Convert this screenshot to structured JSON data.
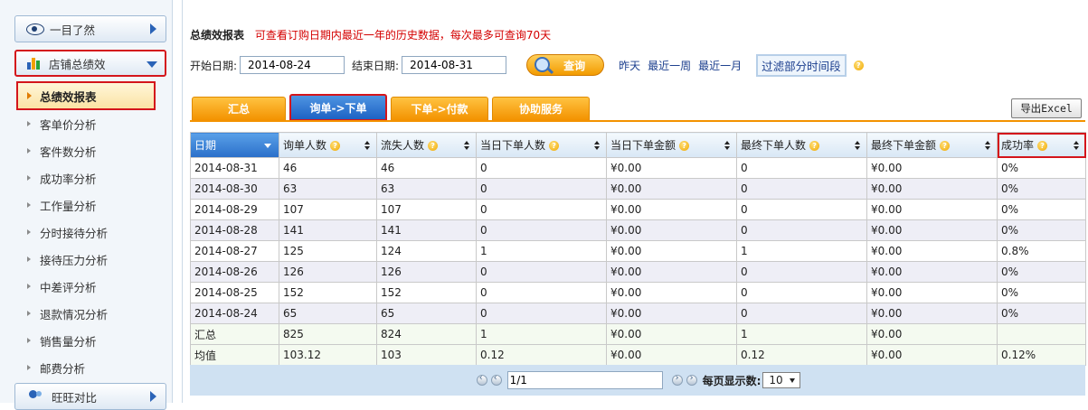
{
  "sidebar": {
    "overview_label": "一目了然",
    "store_label": "店铺总绩效",
    "active_item": "总绩效报表",
    "items": [
      "客单价分析",
      "客件数分析",
      "成功率分析",
      "工作量分析",
      "分时接待分析",
      "接待压力分析",
      "中差评分析",
      "退款情况分析",
      "销售量分析",
      "邮费分析"
    ],
    "wangwang_label": "旺旺对比"
  },
  "header": {
    "title": "总绩效报表",
    "note": "可查看订购日期内最近一年的历史数据，每次最多可查询70天"
  },
  "filter": {
    "start_label": "开始日期:",
    "start_value": "2014-08-24",
    "end_label": "结束日期:",
    "end_value": "2014-08-31",
    "query_label": "查询",
    "quick_links": [
      "昨天",
      "最近一周",
      "最近一月"
    ],
    "partial_label": "过滤部分时间段"
  },
  "tabs": [
    "汇总",
    "询单->下单",
    "下单->付款",
    "协助服务"
  ],
  "active_tab": 1,
  "export_label": "导出Excel",
  "table": {
    "columns": [
      "日期",
      "询单人数",
      "流失人数",
      "当日下单人数",
      "当日下单金额",
      "最终下单人数",
      "最终下单金额",
      "成功率"
    ],
    "rows": [
      [
        "2014-08-31",
        "46",
        "46",
        "0",
        "¥0.00",
        "0",
        "¥0.00",
        "0%"
      ],
      [
        "2014-08-30",
        "63",
        "63",
        "0",
        "¥0.00",
        "0",
        "¥0.00",
        "0%"
      ],
      [
        "2014-08-29",
        "107",
        "107",
        "0",
        "¥0.00",
        "0",
        "¥0.00",
        "0%"
      ],
      [
        "2014-08-28",
        "141",
        "141",
        "0",
        "¥0.00",
        "0",
        "¥0.00",
        "0%"
      ],
      [
        "2014-08-27",
        "125",
        "124",
        "1",
        "¥0.00",
        "1",
        "¥0.00",
        "0.8%"
      ],
      [
        "2014-08-26",
        "126",
        "126",
        "0",
        "¥0.00",
        "0",
        "¥0.00",
        "0%"
      ],
      [
        "2014-08-25",
        "152",
        "152",
        "0",
        "¥0.00",
        "0",
        "¥0.00",
        "0%"
      ],
      [
        "2014-08-24",
        "65",
        "65",
        "0",
        "¥0.00",
        "0",
        "¥0.00",
        "0%"
      ]
    ],
    "summary": [
      "汇总",
      "825",
      "824",
      "1",
      "¥0.00",
      "1",
      "¥0.00",
      ""
    ],
    "average": [
      "均值",
      "103.12",
      "103",
      "0.12",
      "¥0.00",
      "0.12",
      "¥0.00",
      "0.12%"
    ]
  },
  "pager": {
    "page_value": "1/1",
    "per_page_label": "每页显示数:",
    "per_page_value": "10"
  },
  "colors": {
    "accent_orange": "#f39200",
    "active_blue": "#2a6fc9",
    "highlight_red": "#d4151b",
    "note_red": "#d40000"
  }
}
